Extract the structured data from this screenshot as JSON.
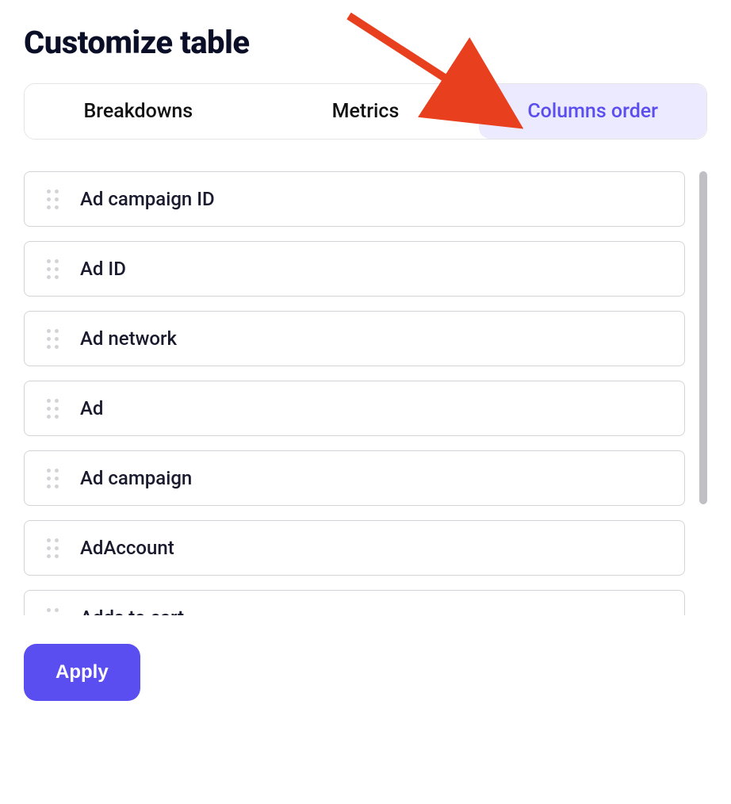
{
  "title": "Customize table",
  "tabs": [
    {
      "label": "Breakdowns",
      "active": false
    },
    {
      "label": "Metrics",
      "active": false
    },
    {
      "label": "Columns order",
      "active": true
    }
  ],
  "columns": [
    "Ad campaign ID",
    "Ad ID",
    "Ad network",
    "Ad",
    "Ad campaign",
    "AdAccount",
    "Adds to cart"
  ],
  "apply_label": "Apply",
  "colors": {
    "accent": "#5b4ef0",
    "tab_active_bg": "#eceafe",
    "border": "#d4d4d8",
    "arrow": "#e8401f"
  }
}
